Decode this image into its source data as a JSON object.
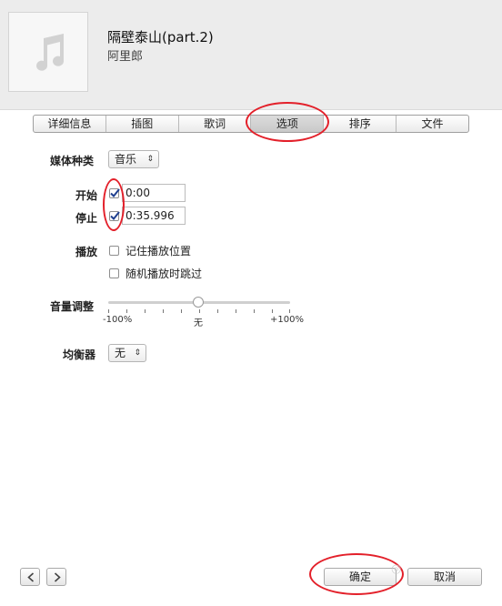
{
  "header": {
    "title": "隔壁泰山(part.2)",
    "artist": "阿里郎"
  },
  "tabs": [
    {
      "label": "详细信息",
      "active": false
    },
    {
      "label": "插图",
      "active": false
    },
    {
      "label": "歌词",
      "active": false
    },
    {
      "label": "选项",
      "active": true
    },
    {
      "label": "排序",
      "active": false
    },
    {
      "label": "文件",
      "active": false
    }
  ],
  "options": {
    "media_kind_label": "媒体种类",
    "media_kind_value": "音乐",
    "start_label": "开始",
    "start_checked": true,
    "start_value": "0:00",
    "stop_label": "停止",
    "stop_checked": true,
    "stop_value": "0:35.996",
    "playback_label": "播放",
    "remember_position_label": "记住播放位置",
    "remember_position_checked": false,
    "skip_shuffle_label": "随机播放时跳过",
    "skip_shuffle_checked": false,
    "volume_label": "音量调整",
    "volume_min_label": "-100%",
    "volume_mid_label": "无",
    "volume_max_label": "+100%",
    "volume_value_percent": 0,
    "eq_label": "均衡器",
    "eq_value": "无"
  },
  "footer": {
    "ok_label": "确定",
    "cancel_label": "取消"
  },
  "colors": {
    "annotation": "#e3202a",
    "active_tab": "#c9c9c9"
  }
}
